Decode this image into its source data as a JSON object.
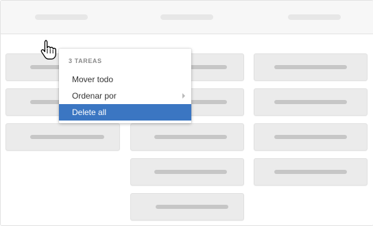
{
  "context_menu": {
    "heading": "3 TAREAS",
    "items": [
      {
        "label": "Mover todo",
        "has_submenu": false,
        "selected": false
      },
      {
        "label": "Ordenar por",
        "has_submenu": true,
        "selected": false
      },
      {
        "label": "Delete all",
        "has_submenu": false,
        "selected": true
      }
    ]
  },
  "columns": [
    {
      "card_count": 3
    },
    {
      "card_count": 5
    },
    {
      "card_count": 4
    }
  ],
  "colors": {
    "selected_item_bg": "#3b76c2",
    "card_bg": "#ebebeb",
    "placeholder_bar": "#c6c6c6"
  },
  "icons": {
    "cursor": "hand-pointer-icon",
    "submenu": "chevron-right-icon"
  }
}
